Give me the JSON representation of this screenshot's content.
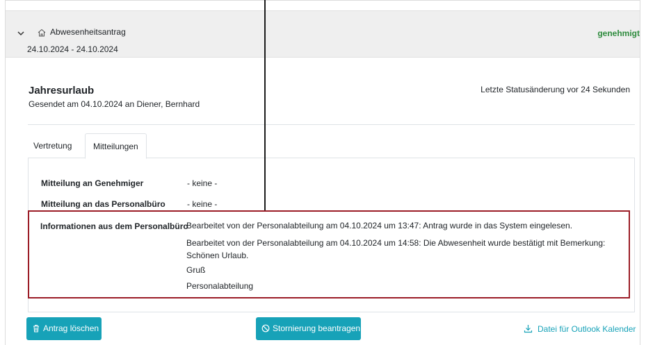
{
  "header": {
    "title": "Abwesenheitsantrag",
    "date_range": "24.10.2024 - 24.10.2024",
    "status": "genehmigt",
    "title_icon": "home-icon",
    "toggle_icon": "chevron-down-icon"
  },
  "request": {
    "title": "Jahresurlaub",
    "subtitle": "Gesendet am 04.10.2024 an Diener, Bernhard",
    "last_change": "Letzte Statusänderung vor 24 Sekunden"
  },
  "tabs": [
    {
      "label": "Vertretung",
      "active": false
    },
    {
      "label": "Mitteilungen",
      "active": true
    }
  ],
  "messages": {
    "rows": [
      {
        "label": "Mitteilung an Genehmiger",
        "value": "- keine -"
      },
      {
        "label": "Mitteilung an das Personalbüro",
        "value": "- keine -"
      }
    ],
    "info_label": "Informationen aus dem Personalbüro",
    "info_lines": [
      "Bearbeitet von der Personalabteilung am 04.10.2024 um 13:47: Antrag wurde in das System eingelesen.",
      "Bearbeitet von der Personalabteilung am 04.10.2024 um 14:58: Die Abwesenheit wurde bestätigt mit Bemerkung: Schönen Urlaub.",
      "Gruß",
      "Personalabteilung"
    ]
  },
  "actions": {
    "delete_label": "Antrag löschen",
    "cancel_label": "Stornierung beantragen",
    "outlook_label": "Datei für Outlook Kalender"
  },
  "colors": {
    "accent": "#17a2b8",
    "status_ok": "#2e8b3d",
    "highlight_border": "#9b1c26"
  }
}
